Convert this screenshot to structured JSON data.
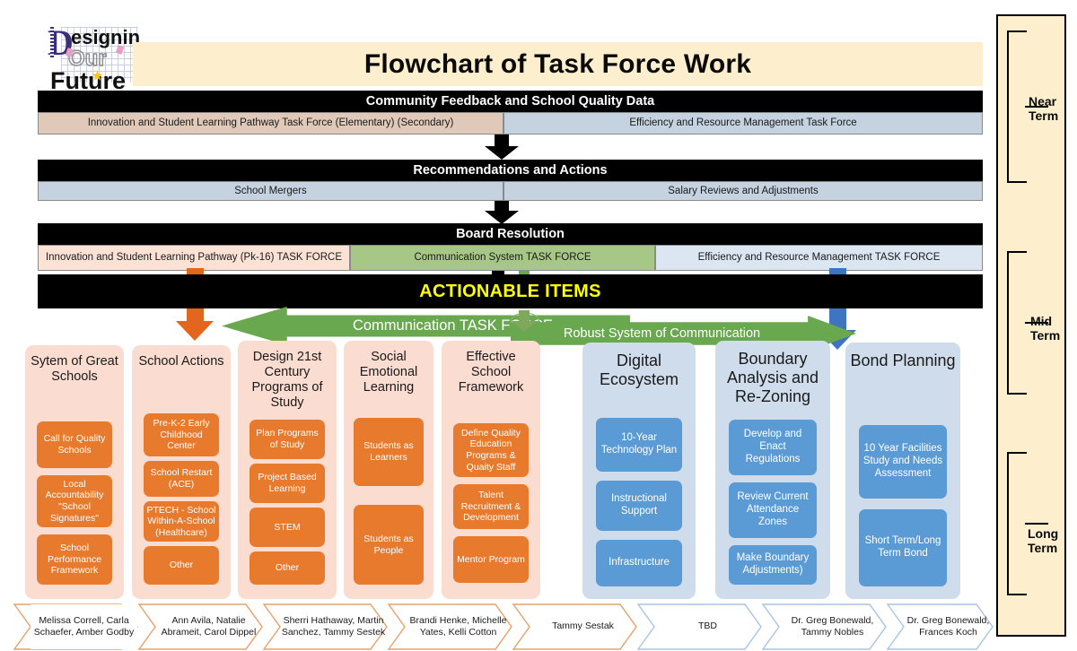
{
  "logo": {
    "word1": "esigning",
    "word2": "Our",
    "word3": "Future",
    "letter": "D"
  },
  "title": "Flowchart of Task Force Work",
  "rows": [
    {
      "header": "Community Feedback and School Quality Data",
      "cells": [
        {
          "label": "Innovation and Student Learning Pathway Task Force (Elementary) (Secondary)",
          "color": "#E0C9B8"
        },
        {
          "label": "Efficiency and Resource Management Task Force",
          "color": "#C5D2E0"
        }
      ]
    },
    {
      "header": "Recommendations and Actions",
      "cells": [
        {
          "label": "School Mergers",
          "color": "#C5D2E0"
        },
        {
          "label": "Salary Reviews and Adjustments",
          "color": "#C5D2E0"
        }
      ]
    },
    {
      "header": "Board Resolution",
      "cells": [
        {
          "label": "Innovation and Student Learning Pathway (Pk-16) TASK FORCE",
          "color": "#FBE2D5"
        },
        {
          "label": "Communication System TASK FORCE",
          "color": "#A6C785"
        },
        {
          "label": "Efficiency and Resource Management TASK FORCE",
          "color": "#DCE6F2"
        }
      ]
    }
  ],
  "actionable_items": "ACTIONABLE ITEMS",
  "banners": {
    "left_arrow": "Communication TASK FORCE",
    "right_arrow": "Robust System of Communication"
  },
  "colors": {
    "orange_chip": "#E87A2E",
    "orange_panel": "#FBDCD0",
    "blue_chip": "#5B9BD5",
    "blue_panel": "#CFDCEC",
    "green": "#6AA84F",
    "black": "#000000",
    "yellow_text": "#FFFF00",
    "cream": "#FDEFCD"
  },
  "columns": [
    {
      "title": "Sytem of Great Schools",
      "theme": "orange",
      "items": [
        "Call for Quality Schools",
        "Local Accountability \"School Signatures\"",
        "School Performance Framework"
      ],
      "owner": "Melissa Correll, Carla Schaefer, Amber Godby"
    },
    {
      "title": "School Actions",
      "theme": "orange",
      "items": [
        "Pre-K-2 Early Childhood Center",
        "School Restart (ACE)",
        "PTECH - School Within-A-School (Healthcare)",
        "Other"
      ],
      "owner": "Ann Avila, Natalie Abrameit, Carol Dippel"
    },
    {
      "title": "Design 21st Century Programs of Study",
      "theme": "orange",
      "items": [
        "Plan Programs of Study",
        "Project Based Learning",
        "STEM",
        "Other"
      ],
      "owner": "Sherri Hathaway, Martin Sanchez, Tammy Sestek"
    },
    {
      "title": "Social Emotional Learning",
      "theme": "orange",
      "items": [
        "Students as Learners",
        "Students as People"
      ],
      "owner": "Brandi Henke, Michelle Yates, Kelli Cotton"
    },
    {
      "title": "Effective School Framework",
      "theme": "orange",
      "items": [
        "Define Quality Education Programs & Quaity Staff",
        "Talent Recruitment & Development",
        "Mentor Program"
      ],
      "owner": "Tammy Sestak"
    },
    {
      "title": "Digital Ecosystem",
      "theme": "blue",
      "items": [
        "10-Year Technology Plan",
        "Instructional Support",
        "Infrastructure"
      ],
      "owner": "TBD"
    },
    {
      "title": "Boundary Analysis and Re-Zoning",
      "theme": "blue",
      "items": [
        "Develop and Enact Regulations",
        "Review Current Attendance Zones",
        "Make Boundary Adjustments)"
      ],
      "owner": "Dr. Greg Bonewald, Tammy Nobles"
    },
    {
      "title": "Bond Planning",
      "theme": "blue",
      "items": [
        "10 Year Facilities Study and Needs Assessment",
        "Short Term/Long Term Bond"
      ],
      "owner": "Dr. Greg Bonewald, Frances Koch"
    }
  ],
  "timeline": [
    {
      "label": "Near\nTerm"
    },
    {
      "label": "Mid\nTerm"
    },
    {
      "label": "Long\nTerm"
    }
  ],
  "timeline_labels": {
    "near_l1": "Near",
    "near_l2": "Term",
    "mid_l1": "Mid",
    "mid_l2": "Term",
    "long_l1": "Long",
    "long_l2": "Term"
  }
}
